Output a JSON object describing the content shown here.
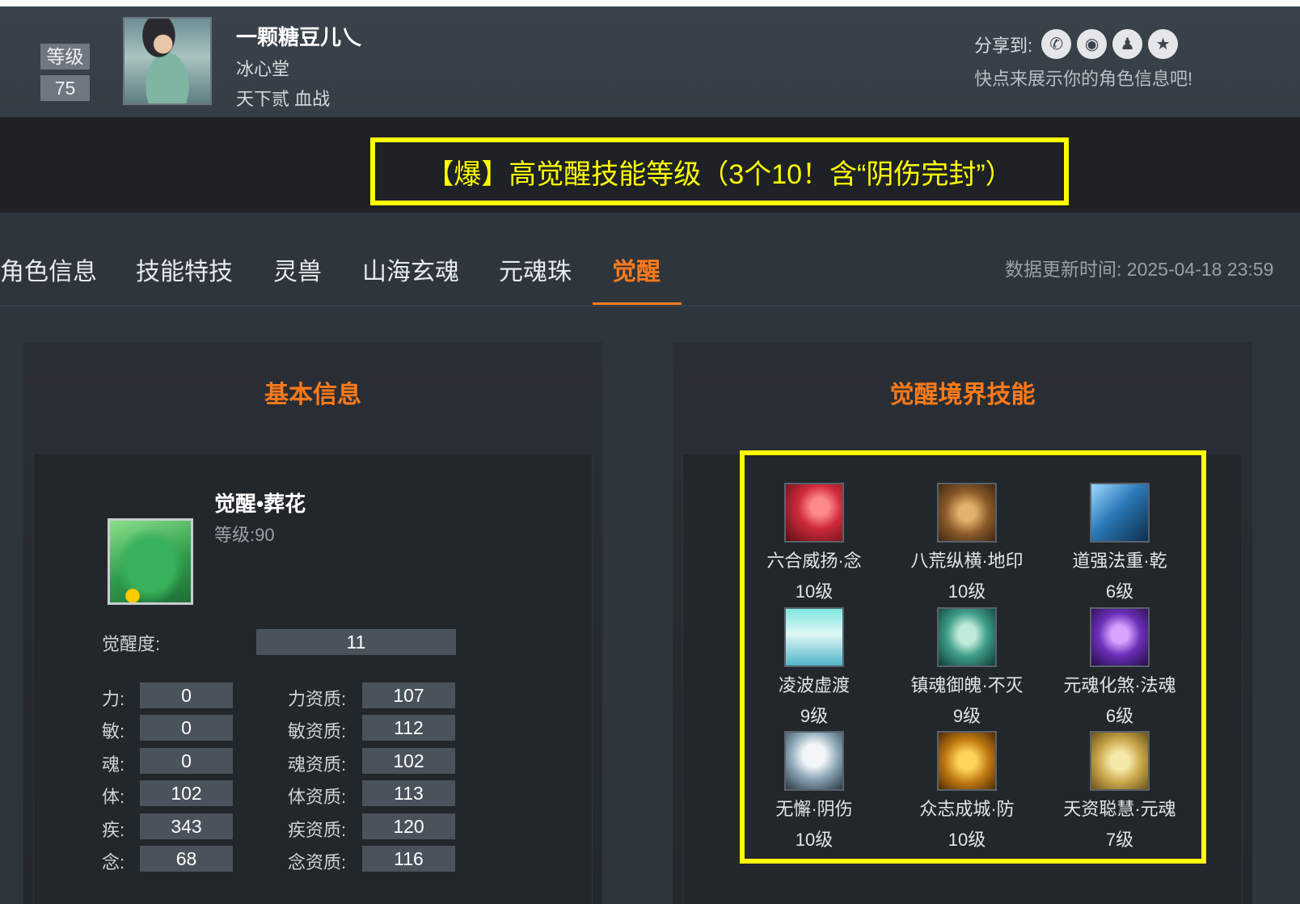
{
  "header": {
    "level_label": "等级",
    "level_value": "75",
    "char_name": "一颗糖豆儿乀",
    "guild": "冰心堂",
    "server": "天下贰 血战",
    "share_label": "分享到:",
    "share_icons": [
      "wechat-icon",
      "weibo-icon",
      "qq-icon",
      "qzone-icon"
    ],
    "share_hint": "快点来展示你的角色信息吧!"
  },
  "banner": {
    "text": "【爆】高觉醒技能等级（3个10！含“阴伤完封”）",
    "color": "#ffff00"
  },
  "tabs": {
    "items": [
      "角色信息",
      "技能特技",
      "灵兽",
      "山海玄魂",
      "元魂珠",
      "觉醒"
    ],
    "active": "觉醒",
    "update_time": "数据更新时间:  2025-04-18 23:59"
  },
  "basic_info": {
    "title": "基本信息",
    "awaken_name": "觉醒•葬花",
    "awaken_level": "等级:90",
    "awaken_degree_label": "觉醒度:",
    "awaken_degree_value": "11",
    "stats": [
      {
        "label": "力:",
        "value": "0",
        "apt_label": "力资质:",
        "apt_value": "107"
      },
      {
        "label": "敏:",
        "value": "0",
        "apt_label": "敏资质:",
        "apt_value": "112"
      },
      {
        "label": "魂:",
        "value": "0",
        "apt_label": "魂资质:",
        "apt_value": "102"
      },
      {
        "label": "体:",
        "value": "102",
        "apt_label": "体资质:",
        "apt_value": "113"
      },
      {
        "label": "疾:",
        "value": "343",
        "apt_label": "疾资质:",
        "apt_value": "120"
      },
      {
        "label": "念:",
        "value": "68",
        "apt_label": "念资质:",
        "apt_value": "116"
      }
    ]
  },
  "awaken_skills": {
    "title": "觉醒境界技能",
    "items": [
      {
        "name": "六合威扬·念",
        "level": "10级"
      },
      {
        "name": "八荒纵横·地印",
        "level": "10级"
      },
      {
        "name": "道强法重·乾",
        "level": "6级"
      },
      {
        "name": "凌波虚渡",
        "level": "9级"
      },
      {
        "name": "镇魂御魄·不灭",
        "level": "9级"
      },
      {
        "name": "元魂化煞·法魂",
        "level": "6级"
      },
      {
        "name": "无懈·阴伤",
        "level": "10级"
      },
      {
        "name": "众志成城·防",
        "level": "10级"
      },
      {
        "name": "天资聪慧·元魂",
        "level": "7级"
      }
    ]
  },
  "colors": {
    "accent": "#ff7a1a",
    "highlight": "#ffff00",
    "background": "#2e353d"
  }
}
